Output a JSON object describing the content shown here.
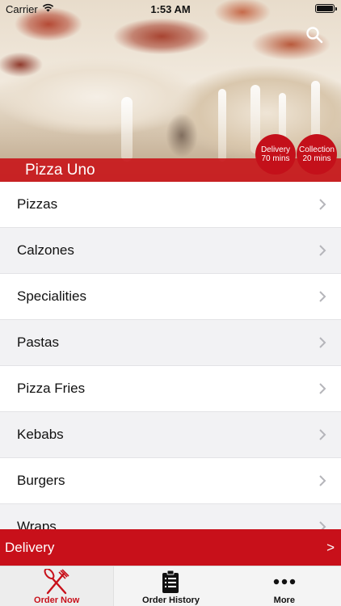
{
  "status_bar": {
    "carrier": "Carrier",
    "time": "1:53 AM"
  },
  "header": {
    "restaurant_name": "Pizza Uno",
    "delivery_badge": {
      "line1": "Delivery",
      "line2": "70 mins"
    },
    "collection_badge": {
      "line1": "Collection",
      "line2": "20 mins"
    },
    "search_icon": "search-icon"
  },
  "menu": {
    "categories": [
      {
        "label": "Pizzas"
      },
      {
        "label": "Calzones"
      },
      {
        "label": "Specialities"
      },
      {
        "label": "Pastas"
      },
      {
        "label": "Pizza Fries"
      },
      {
        "label": "Kebabs"
      },
      {
        "label": "Burgers"
      },
      {
        "label": "Wraps"
      }
    ]
  },
  "order_mode": {
    "label": "Delivery",
    "arrow": ">"
  },
  "tabs": [
    {
      "label": "Order Now",
      "icon": "fork-knife-icon",
      "active": true
    },
    {
      "label": "Order History",
      "icon": "clipboard-icon",
      "active": false
    },
    {
      "label": "More",
      "icon": "more-dots-icon",
      "active": false
    }
  ],
  "colors": {
    "accent": "#c8101a",
    "row_alt": "#f2f2f4",
    "tab_bar": "#f4f4f4"
  }
}
